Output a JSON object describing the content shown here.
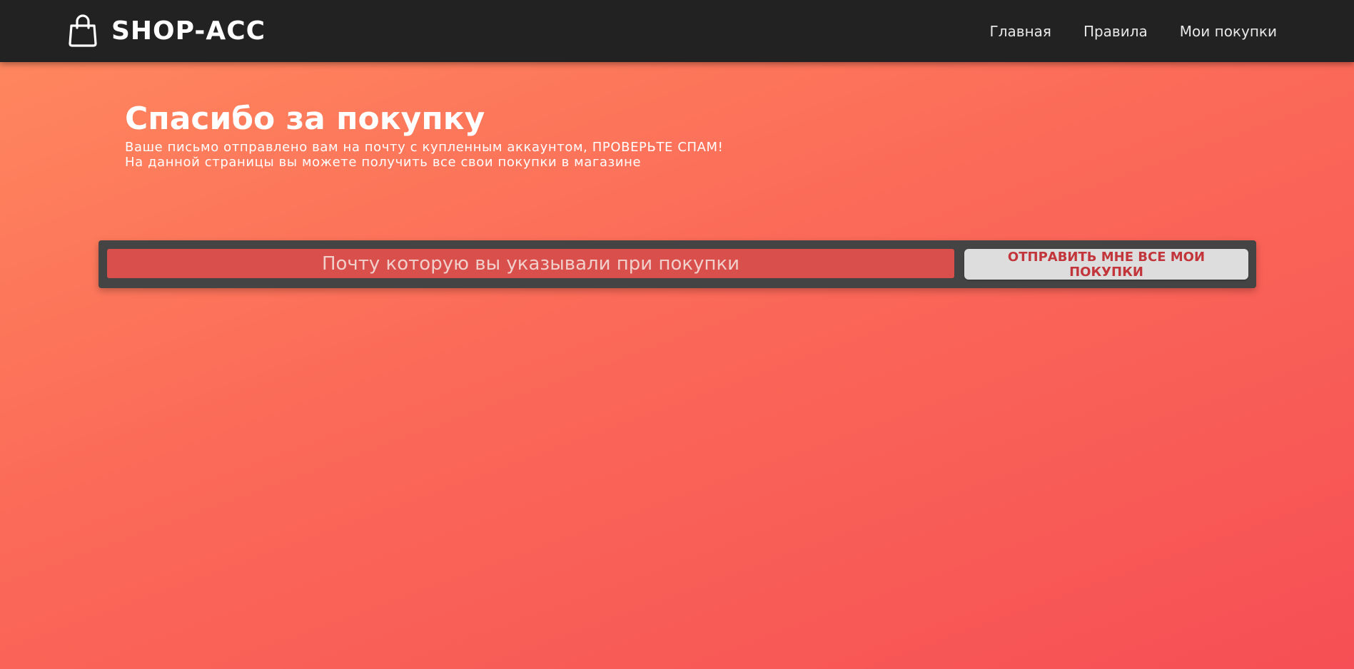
{
  "header": {
    "brand": "SHOP-ACC",
    "brand_icon": "shopping-bag-icon",
    "nav": [
      {
        "label": "Главная"
      },
      {
        "label": "Правила"
      },
      {
        "label": "Мои покупки"
      }
    ]
  },
  "hero": {
    "title": "Спасибо за покупку",
    "line1": "Ваше письмо отправлено вам на почту с купленным аккаунтом, ПРОВЕРЬТЕ СПАМ!",
    "line2": "На данной страницы вы можете получить все свои покупки в магазине"
  },
  "form": {
    "email_placeholder": "Почту которую вы указывали при покупки",
    "email_value": "",
    "submit_label": "ОТПРАВИТЬ МНЕ ВСЕ МОИ ПОКУПКИ"
  },
  "colors": {
    "header_bg": "#222222",
    "gradient_start": "#ff8a5f",
    "gradient_end": "#f64f55",
    "panel_bg": "#444444",
    "input_bg": "#d94f4c",
    "button_bg": "#dddddd",
    "button_text": "#c2353b"
  }
}
